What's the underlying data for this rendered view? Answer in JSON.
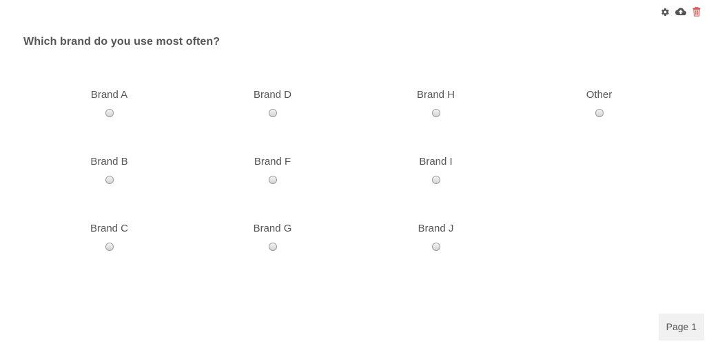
{
  "question": {
    "title": "Which brand do you use most often?"
  },
  "options": [
    {
      "label": "Brand A",
      "selected": false
    },
    {
      "label": "Brand D",
      "selected": false
    },
    {
      "label": "Brand H",
      "selected": false
    },
    {
      "label": "Other",
      "selected": false
    },
    {
      "label": "Brand B",
      "selected": false
    },
    {
      "label": "Brand F",
      "selected": false
    },
    {
      "label": "Brand I",
      "selected": false
    },
    {
      "label": "",
      "selected": false,
      "empty": true
    },
    {
      "label": "Brand C",
      "selected": false
    },
    {
      "label": "Brand G",
      "selected": false
    },
    {
      "label": "Brand J",
      "selected": false
    }
  ],
  "toolbar": {
    "icons": [
      "gear-icon",
      "cloud-upload-icon",
      "trash-icon"
    ],
    "trash_color": "#d9534f",
    "icon_color": "#555555"
  },
  "footer": {
    "page_label": "Page 1"
  }
}
